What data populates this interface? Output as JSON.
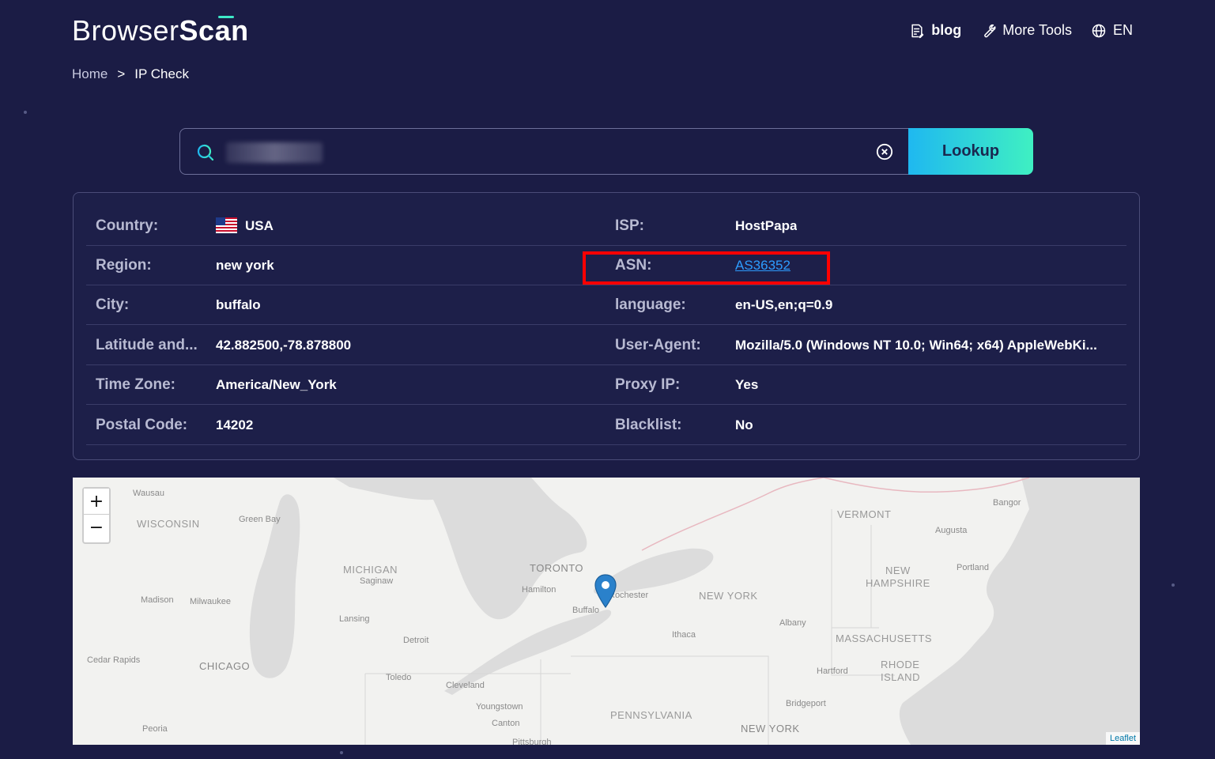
{
  "header": {
    "logo_browser": "Browser",
    "logo_scan": "Scan",
    "nav": [
      {
        "label": "blog",
        "icon": "document-icon"
      },
      {
        "label": "More Tools",
        "icon": "wrench-icon"
      },
      {
        "label": "EN",
        "icon": "globe-icon"
      }
    ]
  },
  "breadcrumb": {
    "home": "Home",
    "separator": ">",
    "current": "IP Check"
  },
  "search": {
    "value": "",
    "button_label": "Lookup"
  },
  "info": {
    "left": [
      {
        "label": "Country:",
        "value": "USA"
      },
      {
        "label": "Region:",
        "value": "new york"
      },
      {
        "label": "City:",
        "value": "buffalo"
      },
      {
        "label": "Latitude and...",
        "value": "42.882500,-78.878800"
      },
      {
        "label": "Time Zone:",
        "value": "America/New_York"
      },
      {
        "label": "Postal Code:",
        "value": "14202"
      }
    ],
    "right": [
      {
        "label": "ISP:",
        "value": "HostPapa"
      },
      {
        "label": "ASN:",
        "value": "AS36352"
      },
      {
        "label": "language:",
        "value": "en-US,en;q=0.9"
      },
      {
        "label": "User-Agent:",
        "value": "Mozilla/5.0 (Windows NT 10.0; Win64; x64) AppleWebKi..."
      },
      {
        "label": "Proxy IP:",
        "value": "Yes"
      },
      {
        "label": "Blacklist:",
        "value": "No"
      }
    ]
  },
  "map": {
    "zoom_in": "+",
    "zoom_out": "−",
    "attribution": "Leaflet",
    "labels": {
      "wausau": "Wausau",
      "wisconsin": "WISCONSIN",
      "green_bay": "Green Bay",
      "michigan": "MICHIGAN",
      "saginaw": "Saginaw",
      "toronto": "TORONTO",
      "hamilton": "Hamilton",
      "rochester": "Rochester",
      "buffalo": "Buffalo",
      "new_york_state": "NEW YORK",
      "vermont": "VERMONT",
      "bangor": "Bangor",
      "augusta": "Augusta",
      "new_hampshire_1": "NEW",
      "new_hampshire_2": "HAMPSHIRE",
      "portland": "Portland",
      "madison": "Madison",
      "milwaukee": "Milwaukee",
      "lansing": "Lansing",
      "detroit": "Detroit",
      "ithaca": "Ithaca",
      "albany": "Albany",
      "massachusetts": "MASSACHUSETTS",
      "cedar_rapids": "Cedar Rapids",
      "chicago": "CHICAGO",
      "toledo": "Toledo",
      "cleveland": "Cleveland",
      "hartford": "Hartford",
      "rhode_1": "RHODE",
      "rhode_2": "ISLAND",
      "youngstown": "Youngstown",
      "canton": "Canton",
      "pittsburgh": "Pittsburgh",
      "pennsylvania": "PENNSYLVANIA",
      "bridgeport": "Bridgeport",
      "new_york_city": "NEW YORK",
      "peoria": "Peoria"
    }
  },
  "colors": {
    "background": "#1b1c45",
    "accent_start": "#1fb8f0",
    "accent_end": "#3ff0c2",
    "link": "#2d9cff",
    "highlight": "#ff0000"
  }
}
